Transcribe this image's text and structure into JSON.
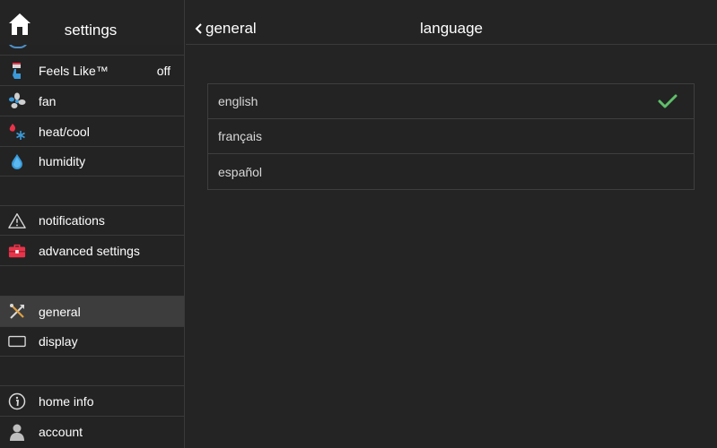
{
  "sidebar": {
    "title": "settings",
    "items": [
      {
        "label": "Feels Like™",
        "value": "off",
        "icon": "thermometer-hand-icon"
      },
      {
        "label": "fan",
        "icon": "fan-icon"
      },
      {
        "label": "heat/cool",
        "icon": "heat-cool-icon"
      },
      {
        "label": "humidity",
        "icon": "water-drop-icon"
      },
      {
        "label": "notifications",
        "icon": "warning-icon"
      },
      {
        "label": "advanced settings",
        "icon": "toolbox-icon"
      },
      {
        "label": "general",
        "icon": "tools-icon",
        "selected": true
      },
      {
        "label": "display",
        "icon": "display-icon"
      },
      {
        "label": "home info",
        "icon": "info-icon"
      },
      {
        "label": "account",
        "icon": "person-icon"
      }
    ]
  },
  "header": {
    "back_label": "general",
    "title": "language"
  },
  "languages": [
    {
      "label": "english",
      "selected": true
    },
    {
      "label": "français",
      "selected": false
    },
    {
      "label": "español",
      "selected": false
    }
  ],
  "colors": {
    "background": "#242424",
    "selected_row": "#3d3d3d",
    "check": "#5fbf6a",
    "accent_blue": "#3a9ad9",
    "accent_red": "#e8344a"
  }
}
